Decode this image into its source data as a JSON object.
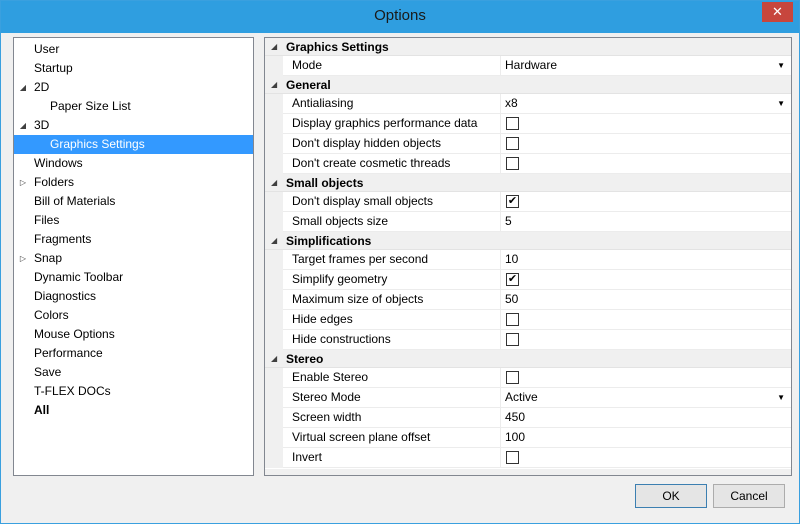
{
  "window": {
    "title": "Options",
    "close_glyph": "✕"
  },
  "tree": {
    "items": [
      {
        "label": "User",
        "expander": ""
      },
      {
        "label": "Startup",
        "expander": ""
      },
      {
        "label": "2D",
        "expander": "◢"
      },
      {
        "label": "Paper Size List",
        "expander": ""
      },
      {
        "label": "3D",
        "expander": "◢"
      },
      {
        "label": "Graphics Settings",
        "expander": ""
      },
      {
        "label": "Windows",
        "expander": ""
      },
      {
        "label": "Folders",
        "expander": "▷"
      },
      {
        "label": "Bill of Materials",
        "expander": ""
      },
      {
        "label": "Files",
        "expander": ""
      },
      {
        "label": "Fragments",
        "expander": ""
      },
      {
        "label": "Snap",
        "expander": "▷"
      },
      {
        "label": "Dynamic Toolbar",
        "expander": ""
      },
      {
        "label": "Diagnostics",
        "expander": ""
      },
      {
        "label": "Colors",
        "expander": ""
      },
      {
        "label": "Mouse Options",
        "expander": ""
      },
      {
        "label": "Performance",
        "expander": ""
      },
      {
        "label": "Save",
        "expander": ""
      },
      {
        "label": "T-FLEX DOCs",
        "expander": ""
      },
      {
        "label": "All",
        "expander": ""
      }
    ]
  },
  "grid": {
    "categories": [
      {
        "label": "Graphics Settings",
        "tri": "◢",
        "rows": [
          {
            "name": "Mode",
            "value": "Hardware",
            "dropdown": "▼"
          }
        ]
      },
      {
        "label": "General",
        "tri": "◢",
        "rows": [
          {
            "name": "Antialiasing",
            "value": "x8",
            "dropdown": "▼"
          },
          {
            "name": "Display graphics performance data",
            "checked": false
          },
          {
            "name": "Don't display hidden objects",
            "checked": false
          },
          {
            "name": "Don't create cosmetic threads",
            "checked": false
          }
        ]
      },
      {
        "label": "Small objects",
        "tri": "◢",
        "rows": [
          {
            "name": "Don't display small objects",
            "checked": true,
            "check_glyph": "✔"
          },
          {
            "name": "Small objects size",
            "value": "5"
          }
        ]
      },
      {
        "label": "Simplifications",
        "tri": "◢",
        "rows": [
          {
            "name": "Target frames per second",
            "value": "10"
          },
          {
            "name": "Simplify geometry",
            "checked": true,
            "check_glyph": "✔"
          },
          {
            "name": "Maximum size of objects",
            "value": "50"
          },
          {
            "name": "Hide edges",
            "checked": false
          },
          {
            "name": "Hide constructions",
            "checked": false
          }
        ]
      },
      {
        "label": "Stereo",
        "tri": "◢",
        "rows": [
          {
            "name": "Enable Stereo",
            "checked": false
          },
          {
            "name": "Stereo Mode",
            "value": "Active",
            "dropdown": "▼"
          },
          {
            "name": "Screen width",
            "value": "450"
          },
          {
            "name": "Virtual screen plane offset",
            "value": "100"
          },
          {
            "name": "Invert",
            "checked": false
          }
        ]
      }
    ]
  },
  "buttons": {
    "ok": "OK",
    "cancel": "Cancel"
  },
  "colors": {
    "titlebar": "#2f9ee0",
    "selection": "#3399ff",
    "close": "#c7463d"
  }
}
